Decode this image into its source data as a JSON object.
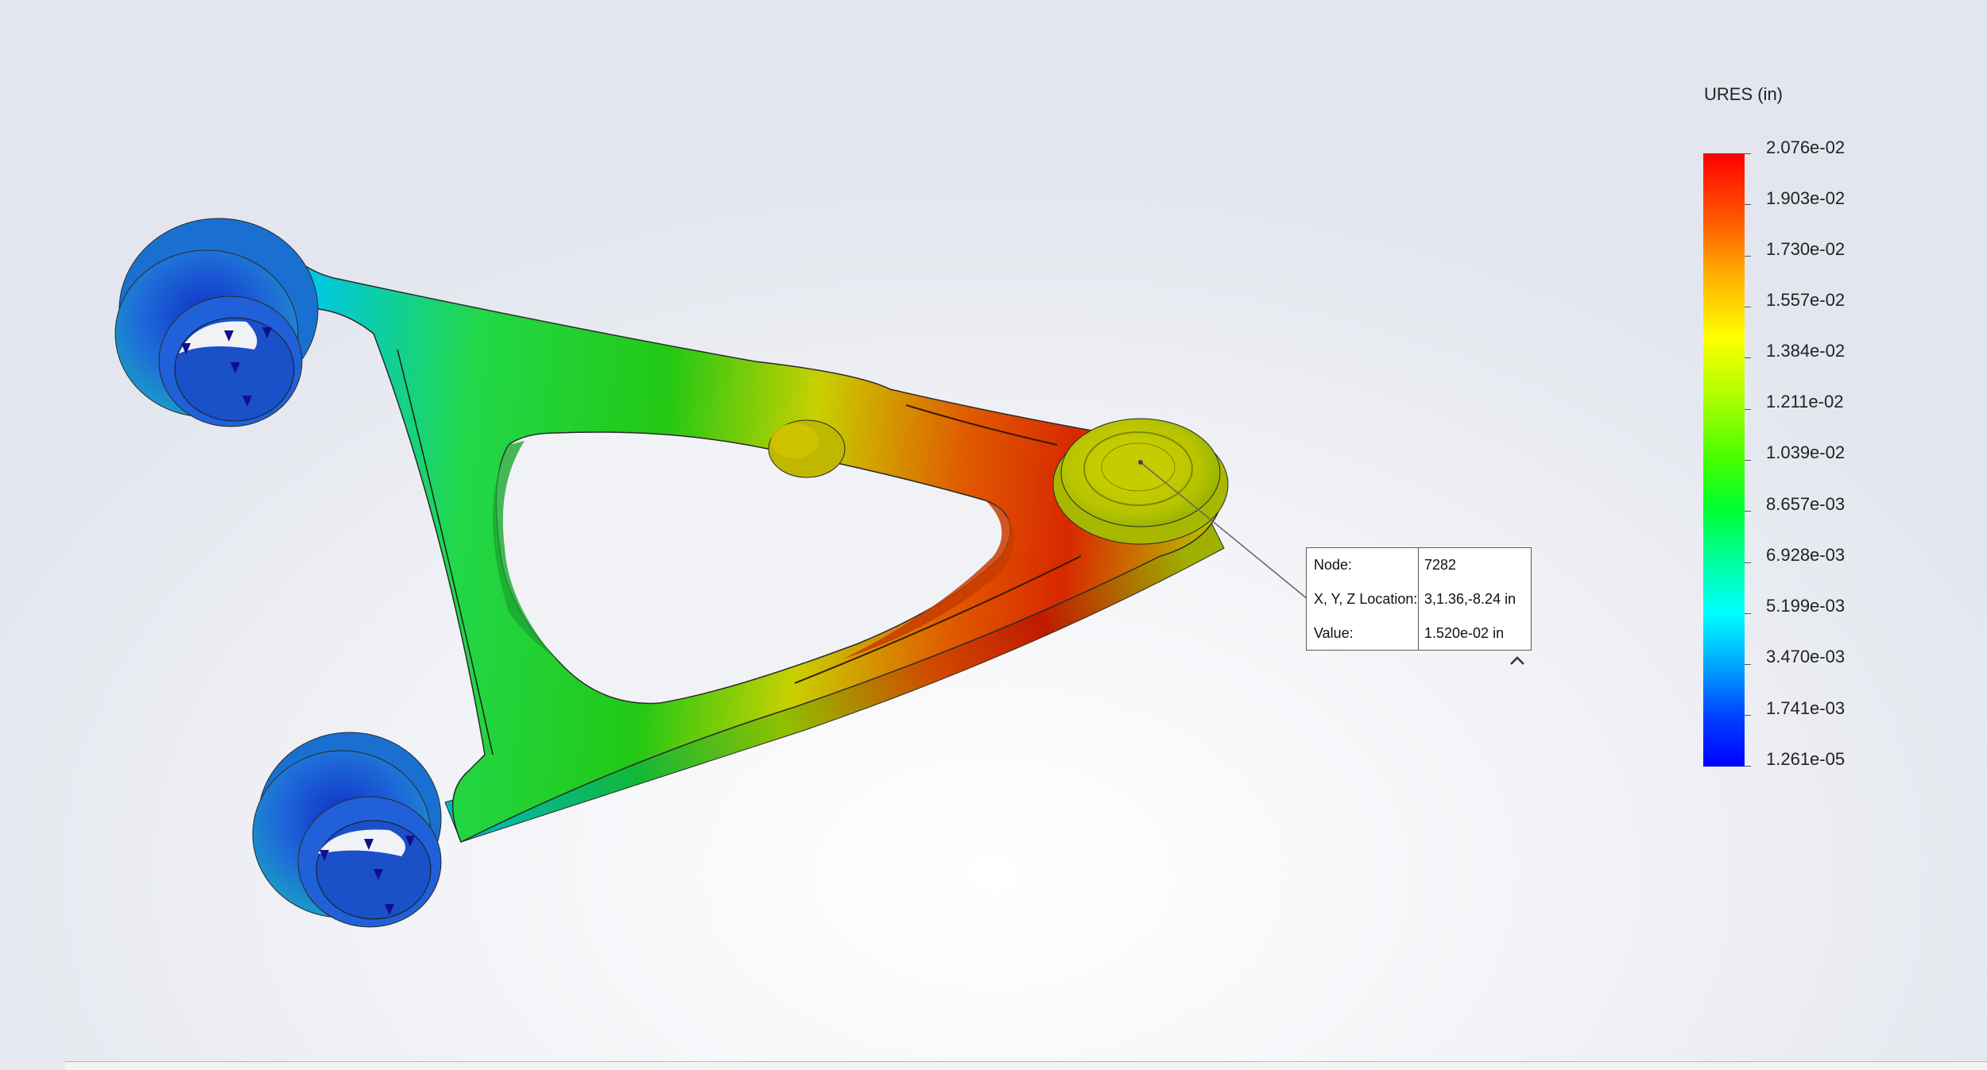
{
  "legend": {
    "title": "URES (in)",
    "labels": [
      "2.076e-02",
      "1.903e-02",
      "1.730e-02",
      "1.557e-02",
      "1.384e-02",
      "1.211e-02",
      "1.039e-02",
      "8.657e-03",
      "6.928e-03",
      "5.199e-03",
      "3.470e-03",
      "1.741e-03",
      "1.261e-05"
    ],
    "colors": {
      "max": "#ff0000",
      "mid": "#ffff00",
      "min": "#0000ff"
    }
  },
  "probe": {
    "node_label": "Node:",
    "node_value": "7282",
    "location_label": "X, Y, Z Location:",
    "location_value": "3,1.36,-8.24 in",
    "value_label": "Value:",
    "value_value": "1.520e-02  in"
  },
  "icons": {
    "collapse": "chevron-up-icon",
    "fixture": "fixture-arrow-icon"
  }
}
